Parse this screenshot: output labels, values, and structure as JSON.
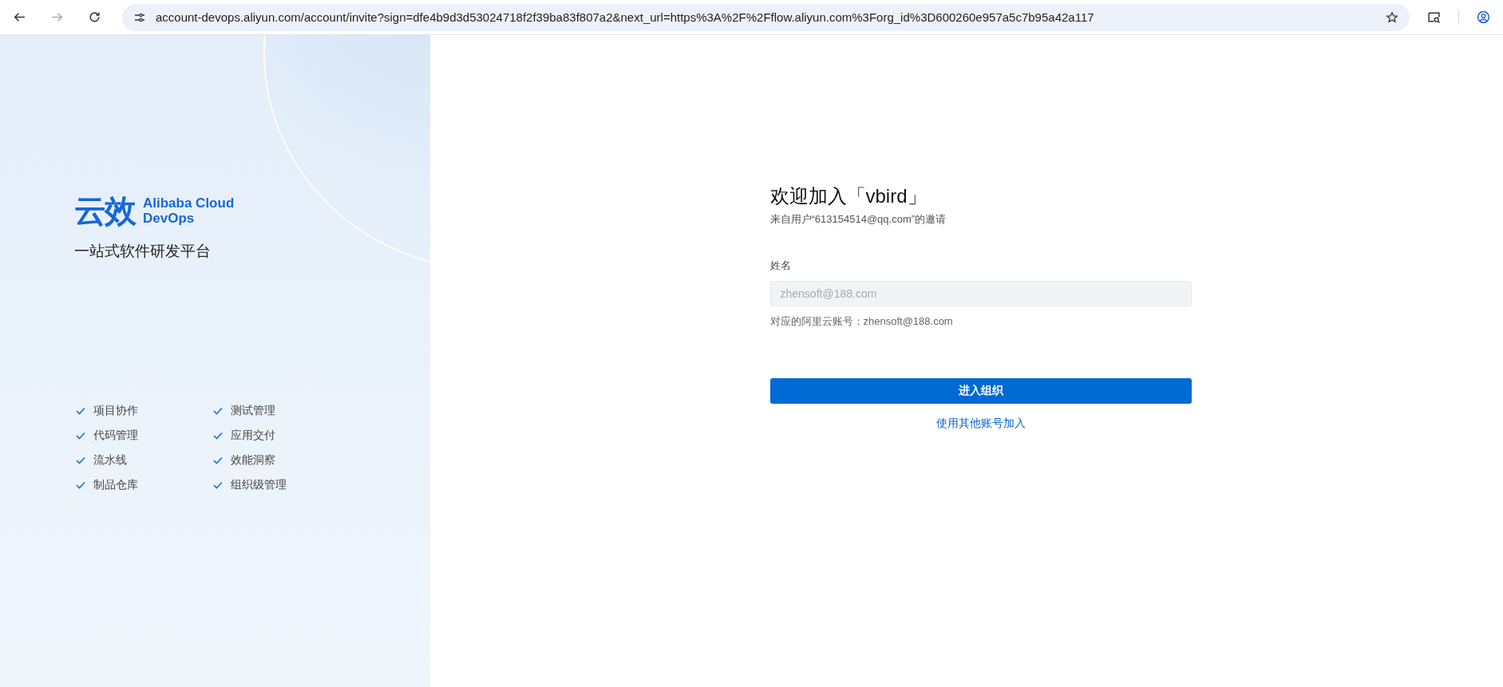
{
  "browser": {
    "url": "account-devops.aliyun.com/account/invite?sign=dfe4b9d3d53024718f2f39ba83f807a2&next_url=https%3A%2F%2Fflow.aliyun.com%3Forg_id%3D600260e957a5c7b95a42a117"
  },
  "brand": {
    "logo_mark": "云效",
    "logo_line_1": "Alibaba Cloud",
    "logo_line_2": "DevOps",
    "tagline": "一站式软件研发平台"
  },
  "features": [
    {
      "label": "项目协作"
    },
    {
      "label": "测试管理"
    },
    {
      "label": "代码管理"
    },
    {
      "label": "应用交付"
    },
    {
      "label": "流水线"
    },
    {
      "label": "效能洞察"
    },
    {
      "label": "制品仓库"
    },
    {
      "label": "组织级管理"
    }
  ],
  "form": {
    "title": "欢迎加入「vbird」",
    "subtitle": "来自用户“613154514@qq.com”的邀请",
    "name_label": "姓名",
    "name_value": "zhensoft@188.com",
    "name_disabled": true,
    "hint": "对应的阿里云账号：zhensoft@188.com",
    "submit": "进入组织",
    "alt_link": "使用其他账号加入"
  }
}
